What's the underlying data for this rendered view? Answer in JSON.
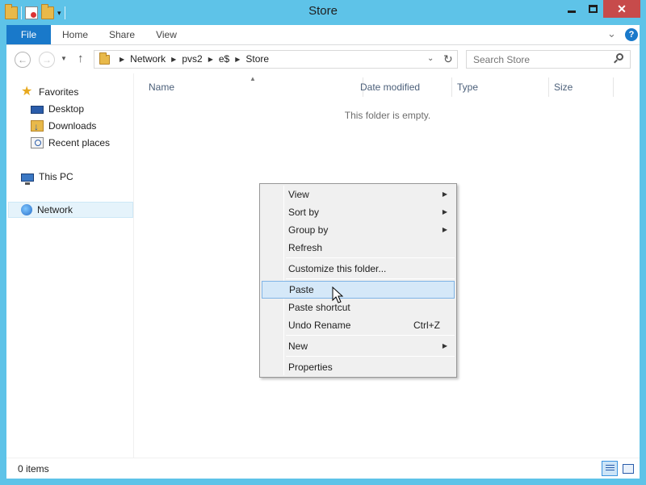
{
  "window": {
    "title": "Store",
    "min_label": "",
    "close_label": "✕"
  },
  "ribbon": {
    "tabs": [
      {
        "label": "File"
      },
      {
        "label": "Home"
      },
      {
        "label": "Share"
      },
      {
        "label": "View"
      }
    ],
    "help_label": "?"
  },
  "address": {
    "crumbs": [
      "Network",
      "pvs2",
      "e$",
      "Store"
    ]
  },
  "search": {
    "placeholder": "Search Store"
  },
  "navpane": {
    "favorites": "Favorites",
    "desktop": "Desktop",
    "downloads": "Downloads",
    "recent": "Recent places",
    "thispc": "This PC",
    "network": "Network"
  },
  "columns": {
    "name": "Name",
    "date": "Date modified",
    "type": "Type",
    "size": "Size"
  },
  "empty_message": "This folder is empty.",
  "context_menu": {
    "view": "View",
    "sort_by": "Sort by",
    "group_by": "Group by",
    "refresh": "Refresh",
    "customize": "Customize this folder...",
    "paste": "Paste",
    "paste_shortcut": "Paste shortcut",
    "undo_rename": "Undo Rename",
    "undo_shortcut": "Ctrl+Z",
    "new": "New",
    "properties": "Properties"
  },
  "status": {
    "items": "0 items"
  },
  "colors": {
    "frame": "#5ec3e8",
    "file_tab": "#1979ca",
    "selection": "#d5e8f8",
    "close_button": "#c74b4b"
  }
}
